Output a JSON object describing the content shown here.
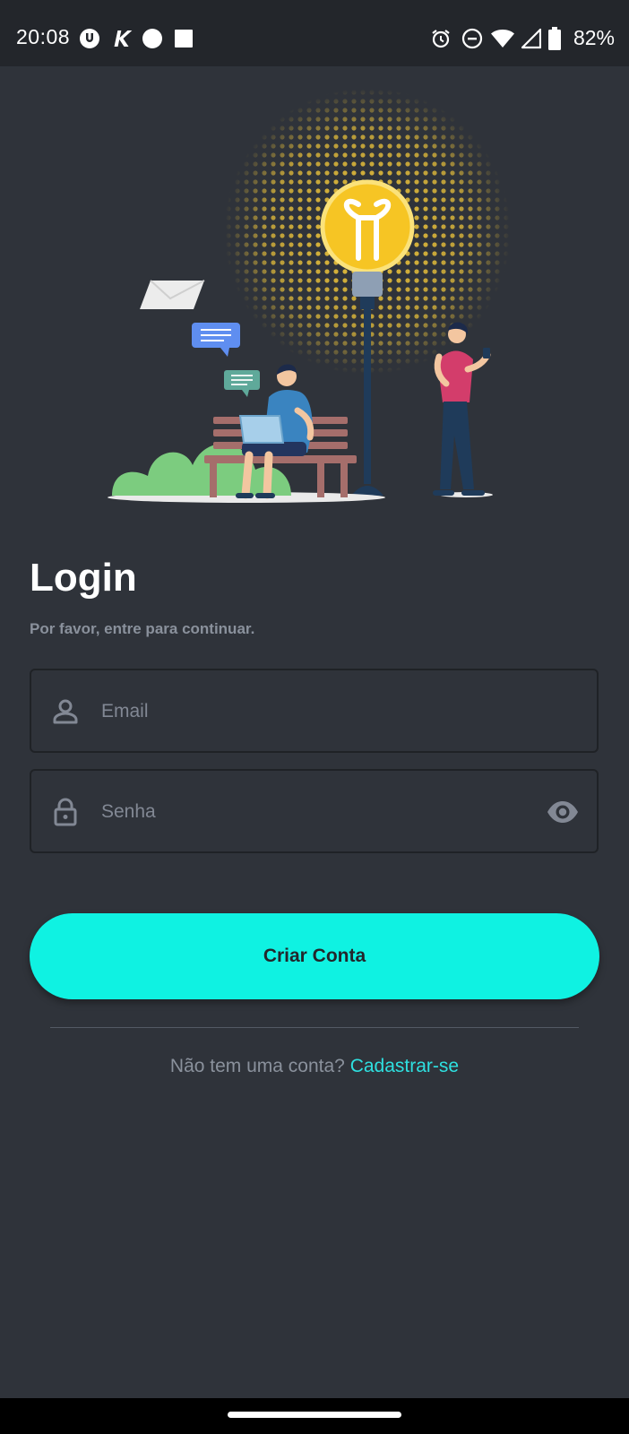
{
  "status_bar": {
    "time": "20:08",
    "battery_percent": "82%",
    "icons_left": [
      "vpn-key-icon",
      "app-k-icon",
      "circle-notification-icon",
      "square-notification-icon"
    ],
    "icons_right": [
      "alarm-icon",
      "do-not-disturb-icon",
      "wifi-icon",
      "cell-signal-icon",
      "battery-icon"
    ]
  },
  "login": {
    "title": "Login",
    "subtitle": "Por favor, entre para continuar.",
    "email_placeholder": "Email",
    "password_placeholder": "Senha",
    "submit_label": "Criar Conta",
    "signup_prompt": "Não tem uma conta?",
    "signup_link": "Cadastrar-se"
  },
  "colors": {
    "background": "#2f333a",
    "accent": "#0ff2e2",
    "link": "#2ee0e0",
    "muted_text": "#8a919c"
  }
}
